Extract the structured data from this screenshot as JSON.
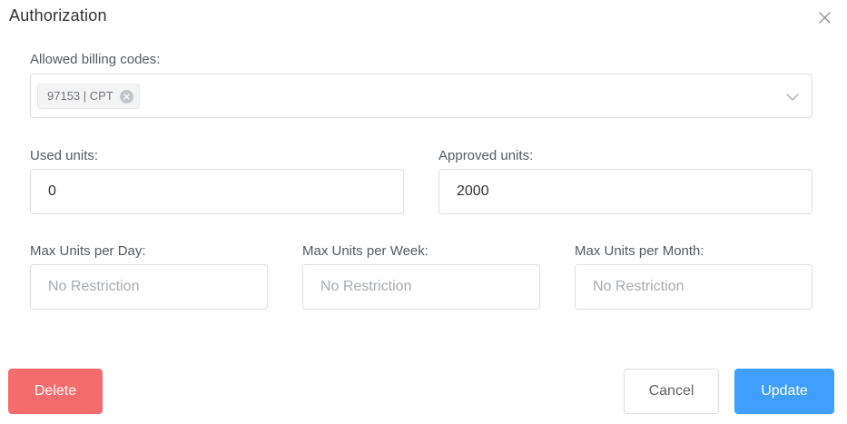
{
  "dialog": {
    "title": "Authorization",
    "close_icon": "close-icon"
  },
  "billing_codes": {
    "label": "Allowed billing codes:",
    "tags": [
      "97153 | CPT"
    ],
    "dropdown_icon": "chevron-down-icon"
  },
  "units": {
    "used_label": "Used units:",
    "used_value": "0",
    "approved_label": "Approved units:",
    "approved_value": "2000"
  },
  "limits": {
    "per_day_label": "Max Units per Day:",
    "per_day_placeholder": "No Restriction",
    "per_week_label": "Max Units per Week:",
    "per_week_placeholder": "No Restriction",
    "per_month_label": "Max Units per Month:",
    "per_month_placeholder": "No Restriction"
  },
  "actions": {
    "delete_label": "Delete",
    "cancel_label": "Cancel",
    "update_label": "Update"
  },
  "colors": {
    "primary": "#409eff",
    "danger": "#f56c6c",
    "border": "#dcdfe6"
  }
}
